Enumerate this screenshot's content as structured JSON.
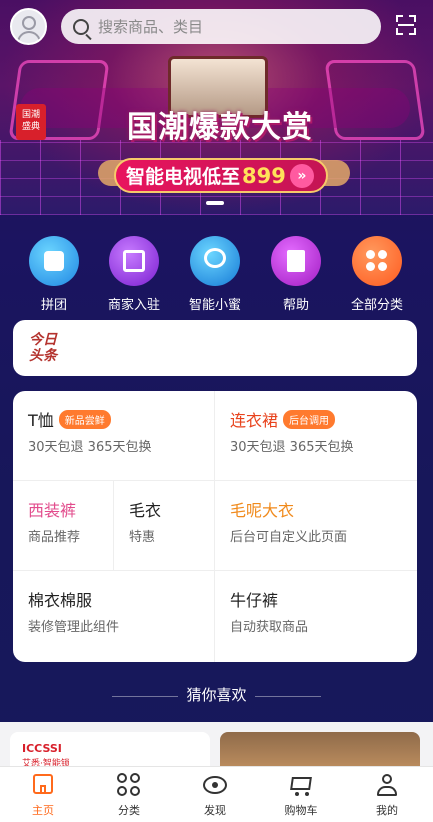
{
  "search": {
    "placeholder": "搜索商品、类目"
  },
  "banner": {
    "badge": "国潮\n盛典",
    "title": "国潮爆款大赏",
    "subtitle": "智能电视低至",
    "price": "899",
    "chevron": "»"
  },
  "nav": [
    {
      "label": "拼团",
      "icon": "group-buy-icon"
    },
    {
      "label": "商家入驻",
      "icon": "merchant-join-icon"
    },
    {
      "label": "智能小蜜",
      "icon": "assistant-icon"
    },
    {
      "label": "帮助",
      "icon": "help-book-icon"
    },
    {
      "label": "全部分类",
      "icon": "all-categories-icon"
    }
  ],
  "headline": {
    "line1": "今日",
    "line2": "头条"
  },
  "categories": [
    {
      "title": "T恤",
      "tag": "新品尝鲜",
      "subtitle": "30天包退 365天包换"
    },
    {
      "title": "连衣裙",
      "tag": "后台调用",
      "subtitle": "30天包退 365天包换"
    },
    {
      "title": "西装裤",
      "subtitle": "商品推荐"
    },
    {
      "title": "毛衣",
      "subtitle": "特惠"
    },
    {
      "title": "毛呢大衣",
      "subtitle": "后台可自定义此页面"
    },
    {
      "title": "棉衣棉服",
      "subtitle": "装修管理此组件"
    },
    {
      "title": "牛仔裤",
      "subtitle": "自动获取商品"
    }
  ],
  "guess": {
    "title": "猜你喜欢"
  },
  "products": [
    {
      "brand": "ICCSSI",
      "brand_sub": "艾悉·智能锁"
    }
  ],
  "tabs": [
    {
      "label": "主页",
      "icon": "home-icon"
    },
    {
      "label": "分类",
      "icon": "category-icon"
    },
    {
      "label": "发现",
      "icon": "discover-icon"
    },
    {
      "label": "购物车",
      "icon": "cart-icon"
    },
    {
      "label": "我的",
      "icon": "profile-icon"
    }
  ],
  "colors": {
    "accent": "#ff6a1c",
    "banner_pink": "#e8145e",
    "price_yellow": "#ffe15a"
  }
}
